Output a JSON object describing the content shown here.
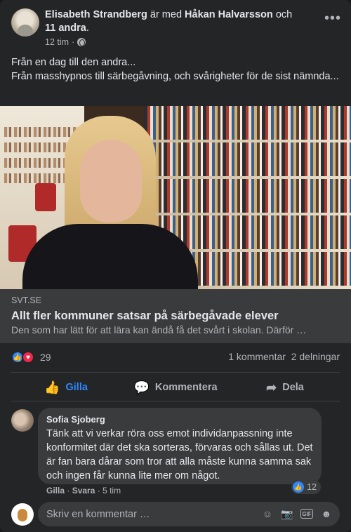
{
  "post": {
    "author": "Elisabeth Strandberg",
    "with_text": "är med",
    "tagged": "Håkan Halvarsson",
    "and_text": "och",
    "others": "11 andra",
    "period": ".",
    "time": "12 tim",
    "sep": "·",
    "text_lines": [
      "Från en dag till den andra...",
      "Från masshypnos till särbegåvning, och svårigheter för de sist nämnda..."
    ]
  },
  "link": {
    "domain": "SVT.SE",
    "title": "Allt fler kommuner satsar på särbegåvade elever",
    "description": "Den som har lätt för att lära kan ändå få det svårt i skolan. Därför …"
  },
  "stats": {
    "reactions": "29",
    "comments": "1 kommentar",
    "shares": "2 delningar"
  },
  "actions": {
    "like": "Gilla",
    "comment": "Kommentera",
    "share": "Dela"
  },
  "comment": {
    "author": "Sofia Sjoberg",
    "text": "Tänk att vi verkar röra oss emot individanpassning inte konformitet där det ska sorteras, förvaras och sållas ut. Det är fan bara dårar som tror att alla måste kunna samma sak och ingen får kunna lite mer om något.",
    "like_label": "Gilla",
    "reply_label": "Svara",
    "sep": "·",
    "time": "5 tim",
    "likes": "12"
  },
  "compose": {
    "placeholder": "Skriv en kommentar …",
    "gif_label": "GIF"
  },
  "colors": {
    "background": "#242526",
    "accent": "#2d88ff",
    "love": "#f0284a",
    "text": "#e4e6eb",
    "muted": "#b0b3b8"
  },
  "icons": [
    "globe-icon",
    "more-icon",
    "like-icon",
    "love-icon",
    "comment-icon",
    "share-icon",
    "emoji-icon",
    "camera-icon",
    "gif-icon",
    "sticker-icon"
  ]
}
